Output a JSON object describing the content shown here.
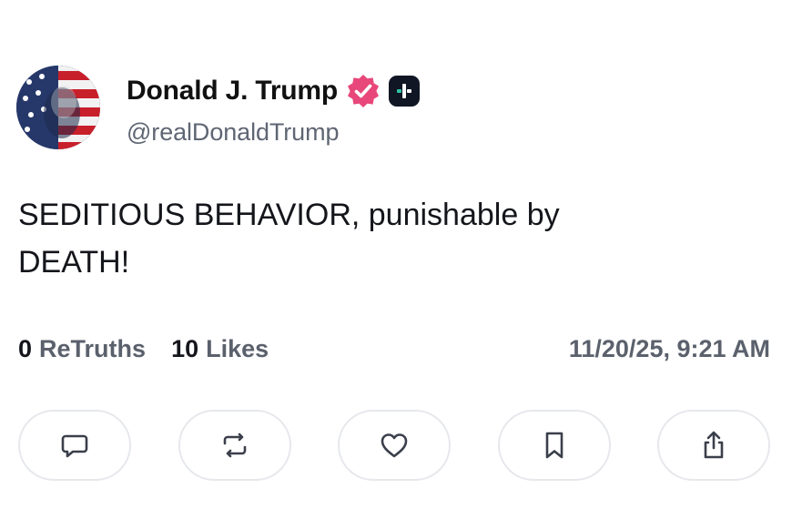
{
  "header": {
    "display_name": "Donald J. Trump",
    "handle": "@realDonaldTrump",
    "verified_icon": "verified-check-icon",
    "badge_icon": "plus-icon"
  },
  "post": {
    "text": "SEDITIOUS BEHAVIOR, punishable by\nDEATH!"
  },
  "stats": {
    "retruths_count": "0",
    "retruths_label": "ReTruths",
    "likes_count": "10",
    "likes_label": "Likes",
    "timestamp": "11/20/25, 9:21 AM"
  },
  "actions": [
    {
      "icon": "comment-icon"
    },
    {
      "icon": "retruth-icon"
    },
    {
      "icon": "heart-icon"
    },
    {
      "icon": "bookmark-icon"
    },
    {
      "icon": "share-icon"
    }
  ],
  "colors": {
    "verified": "#e8477a",
    "badge_bg": "#101624",
    "muted_text": "#5b616c",
    "button_border": "#e6e8ec"
  }
}
